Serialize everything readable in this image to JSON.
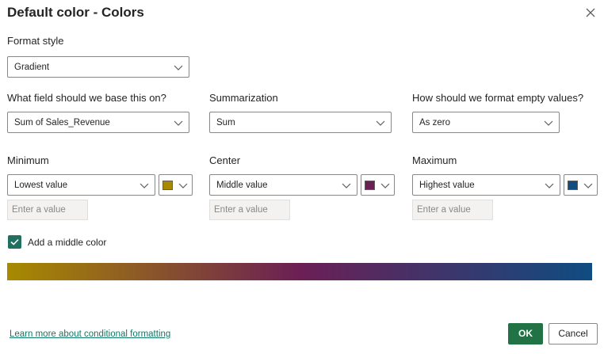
{
  "dialog": {
    "title": "Default color - Colors"
  },
  "format_style": {
    "label": "Format style",
    "value": "Gradient"
  },
  "base_field": {
    "label": "What field should we base this on?",
    "value": "Sum of Sales_Revenue"
  },
  "summarization": {
    "label": "Summarization",
    "value": "Sum"
  },
  "empty_values": {
    "label": "How should we format empty values?",
    "value": "As zero"
  },
  "minimum": {
    "label": "Minimum",
    "value": "Lowest value",
    "color": "#a88a00",
    "input_placeholder": "Enter a value"
  },
  "center": {
    "label": "Center",
    "value": "Middle value",
    "color": "#6b1f55",
    "input_placeholder": "Enter a value"
  },
  "maximum": {
    "label": "Maximum",
    "value": "Highest value",
    "color": "#0f4c81",
    "input_placeholder": "Enter a value"
  },
  "middle_color": {
    "label": "Add a middle color",
    "checked": true
  },
  "footer": {
    "learn_more": "Learn more about conditional formatting",
    "ok_label": "OK",
    "cancel_label": "Cancel"
  },
  "colors": {
    "primary_button": "#217346",
    "link": "#117865",
    "checkbox": "#216f5f"
  },
  "icons": {
    "close": "close-icon",
    "dropdown": "chevron-down-icon",
    "check": "checkmark-icon"
  }
}
